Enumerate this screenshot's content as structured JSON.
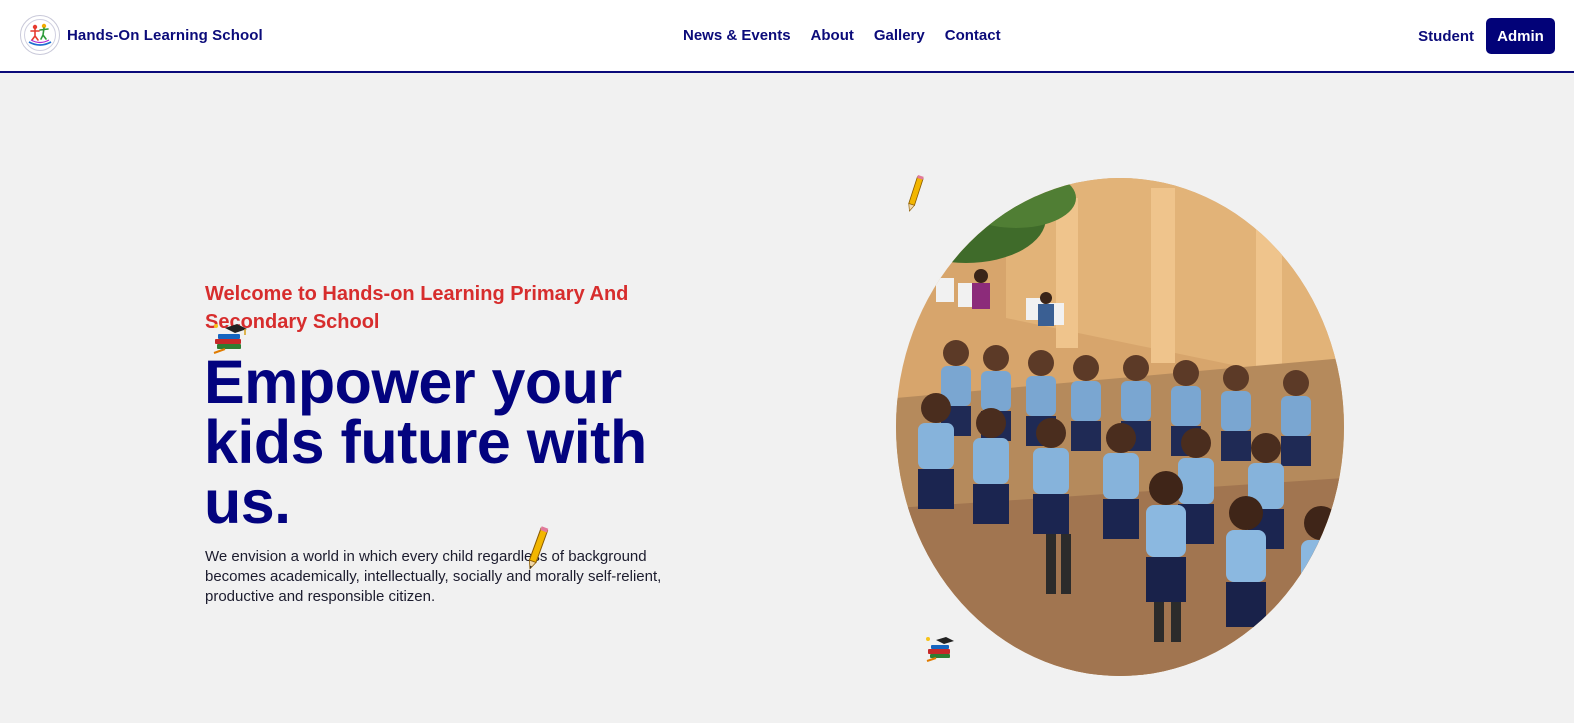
{
  "nav": {
    "brand_name": "Hands-On Learning School",
    "logo_icon": "school-kids-logo-icon",
    "links": [
      {
        "label": "News & Events"
      },
      {
        "label": "About"
      },
      {
        "label": "Gallery"
      },
      {
        "label": "Contact"
      }
    ],
    "student_label": "Student",
    "admin_label": "Admin"
  },
  "hero": {
    "welcome": "Welcome to Hands-on Learning Primary And Secondary School",
    "headline": "Empower your kids future with us.",
    "description": "We envision a world in which every child regardless of background becomes academically, intellectually, socially and morally self-relient, productive and responsible citizen.",
    "image_subject": "school-children-photo"
  },
  "colors": {
    "primary": "#03037f",
    "accent": "#d72d2d",
    "background": "#f1f1f1"
  }
}
